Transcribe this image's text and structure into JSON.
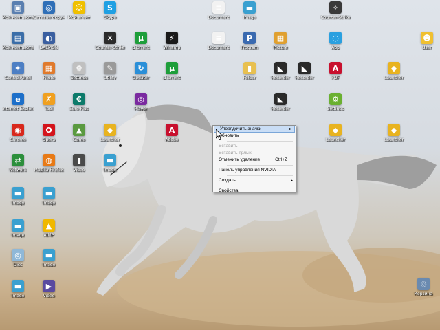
{
  "desktop": {
    "icons": [
      {
        "id": "mycomp1",
        "label": "Мой компьютер",
        "color": "#5a7fb0",
        "glyph": "▣",
        "l": 3,
        "t": 0
      },
      {
        "id": "net",
        "label": "Сетевое окружение",
        "color": "#2f6fb7",
        "glyph": "◎",
        "l": 48,
        "t": 0
      },
      {
        "id": "msg",
        "label": "Мой агент",
        "color": "#f0c000",
        "glyph": "☺",
        "l": 92,
        "t": 0
      },
      {
        "id": "skype",
        "label": "Skype",
        "color": "#1fa0e3",
        "glyph": "S",
        "l": 137,
        "t": 0
      },
      {
        "id": "mycomp2",
        "label": "Мой компьютер",
        "color": "#3b6ea8",
        "glyph": "▤",
        "l": 3,
        "t": 44
      },
      {
        "id": "daemon",
        "label": "DAEMON",
        "color": "#3a5fa0",
        "glyph": "◐",
        "l": 48,
        "t": 44
      },
      {
        "id": "counter",
        "label": "Counter-Strike",
        "color": "#2c2c2c",
        "glyph": "✕",
        "l": 137,
        "t": 44
      },
      {
        "id": "utorrent1",
        "label": "µTorrent",
        "color": "#1d9e3a",
        "glyph": "µ",
        "l": 182,
        "t": 44
      },
      {
        "id": "winamp",
        "label": "Winamp",
        "color": "#1a1a1a",
        "glyph": "⚡",
        "l": 227,
        "t": 44
      },
      {
        "id": "gear",
        "label": "ControlPanel",
        "color": "#4d7fc4",
        "glyph": "✦",
        "l": 3,
        "t": 88
      },
      {
        "id": "photo",
        "label": "Photo",
        "color": "#e07a2c",
        "glyph": "▦",
        "l": 48,
        "t": 88
      },
      {
        "id": "settings",
        "label": "Settings",
        "color": "#c0c0c0",
        "glyph": "⚙",
        "l": 92,
        "t": 88
      },
      {
        "id": "iron",
        "label": "Utility",
        "color": "#9a9a9a",
        "glyph": "✎",
        "l": 137,
        "t": 88
      },
      {
        "id": "updater",
        "label": "Updater",
        "color": "#2a8fd8",
        "glyph": "↻",
        "l": 182,
        "t": 88
      },
      {
        "id": "utorrent2",
        "label": "µTorrent",
        "color": "#1d9e3a",
        "glyph": "µ",
        "l": 227,
        "t": 88
      },
      {
        "id": "ie",
        "label": "Internet Explorer",
        "color": "#1d6fc9",
        "glyph": "e",
        "l": 3,
        "t": 133
      },
      {
        "id": "tool",
        "label": "Tool",
        "color": "#f0a020",
        "glyph": "✗",
        "l": 48,
        "t": 133
      },
      {
        "id": "euro",
        "label": "Euro Plus",
        "color": "#0c7a6a",
        "glyph": "€",
        "l": 92,
        "t": 133
      },
      {
        "id": "chrome",
        "label": "Chrome",
        "color": "#d8281c",
        "glyph": "◉",
        "l": 3,
        "t": 178
      },
      {
        "id": "opera",
        "label": "Opera",
        "color": "#d4141c",
        "glyph": "O",
        "l": 48,
        "t": 178
      },
      {
        "id": "game1",
        "label": "Game",
        "color": "#5a9a40",
        "glyph": "▲",
        "l": 92,
        "t": 178
      },
      {
        "id": "cube1",
        "label": "Launcher",
        "color": "#e8b320",
        "glyph": "◆",
        "l": 137,
        "t": 178
      },
      {
        "id": "adobe",
        "label": "Adobe",
        "color": "#c8102e",
        "glyph": "A",
        "l": 227,
        "t": 178
      },
      {
        "id": "net2",
        "label": "Network",
        "color": "#2c8f3c",
        "glyph": "⇄",
        "l": 3,
        "t": 222
      },
      {
        "id": "firefox",
        "label": "Mozilla Firefox",
        "color": "#e87a16",
        "glyph": "◍",
        "l": 48,
        "t": 222
      },
      {
        "id": "film",
        "label": "Video",
        "color": "#4a4a4a",
        "glyph": "▮",
        "l": 92,
        "t": 222
      },
      {
        "id": "img1",
        "label": "Image",
        "color": "#3aa0d0",
        "glyph": "▬",
        "l": 137,
        "t": 222
      },
      {
        "id": "img2",
        "label": "Image",
        "color": "#3aa0d0",
        "glyph": "▬",
        "l": 3,
        "t": 270
      },
      {
        "id": "img3",
        "label": "Image",
        "color": "#3aa0d0",
        "glyph": "▬",
        "l": 48,
        "t": 270
      },
      {
        "id": "img4",
        "label": "Image",
        "color": "#3aa0d0",
        "glyph": "▬",
        "l": 3,
        "t": 317
      },
      {
        "id": "aimp",
        "label": "AIMP",
        "color": "#f0b800",
        "glyph": "▲",
        "l": 48,
        "t": 317
      },
      {
        "id": "cd",
        "label": "Disc",
        "color": "#8fb8d8",
        "glyph": "◎",
        "l": 3,
        "t": 360
      },
      {
        "id": "img5",
        "label": "Image",
        "color": "#3aa0d0",
        "glyph": "▬",
        "l": 48,
        "t": 360
      },
      {
        "id": "img6",
        "label": "Image",
        "color": "#3aa0d0",
        "glyph": "▬",
        "l": 3,
        "t": 405
      },
      {
        "id": "film2",
        "label": "Video",
        "color": "#5a4aa0",
        "glyph": "▶",
        "l": 48,
        "t": 405
      },
      {
        "id": "word1",
        "label": "Document",
        "color": "#f2f2f2",
        "glyph": "≡",
        "l": 295,
        "t": 0
      },
      {
        "id": "img7",
        "label": "Image",
        "color": "#3aa0d0",
        "glyph": "▬",
        "l": 340,
        "t": 0
      },
      {
        "id": "cs2",
        "label": "Counter-Strike",
        "color": "#3a3a3a",
        "glyph": "✧",
        "l": 465,
        "t": 0
      },
      {
        "id": "doc2",
        "label": "Document",
        "color": "#f2f2f2",
        "glyph": "≡",
        "l": 295,
        "t": 44
      },
      {
        "id": "pp",
        "label": "Program",
        "color": "#3a6ab0",
        "glyph": "P",
        "l": 340,
        "t": 44
      },
      {
        "id": "pic",
        "label": "Picture",
        "color": "#e0a030",
        "glyph": "▦",
        "l": 385,
        "t": 44
      },
      {
        "id": "app",
        "label": "App",
        "color": "#2aa0e0",
        "glyph": "◌",
        "l": 465,
        "t": 44
      },
      {
        "id": "user",
        "label": "User",
        "color": "#f0c030",
        "glyph": "☻",
        "l": 598,
        "t": 44
      },
      {
        "id": "folder",
        "label": "Folder",
        "color": "#e8c050",
        "glyph": "▮",
        "l": 340,
        "t": 88
      },
      {
        "id": "rec1",
        "label": "Recorder",
        "color": "#2a2a2a",
        "glyph": "◣",
        "l": 385,
        "t": 88
      },
      {
        "id": "rec2",
        "label": "Recorder",
        "color": "#2a2a2a",
        "glyph": "◣",
        "l": 420,
        "t": 88
      },
      {
        "id": "pdf",
        "label": "PDF",
        "color": "#c8102e",
        "glyph": "A",
        "l": 465,
        "t": 88
      },
      {
        "id": "cube2",
        "label": "Launcher",
        "color": "#e8b320",
        "glyph": "◆",
        "l": 550,
        "t": 88
      },
      {
        "id": "rec3",
        "label": "Recorder",
        "color": "#2a2a2a",
        "glyph": "◣",
        "l": 385,
        "t": 133
      },
      {
        "id": "gear2",
        "label": "Settings",
        "color": "#6ab030",
        "glyph": "⚙",
        "l": 465,
        "t": 133
      },
      {
        "id": "cube3",
        "label": "Launcher",
        "color": "#e8b320",
        "glyph": "◆",
        "l": 465,
        "t": 178
      },
      {
        "id": "cube4",
        "label": "Launcher",
        "color": "#e8b320",
        "glyph": "◆",
        "l": 550,
        "t": 178
      },
      {
        "id": "purple",
        "label": "Player",
        "color": "#7a2aa0",
        "glyph": "◎",
        "l": 182,
        "t": 133
      },
      {
        "id": "recycle",
        "label": "Корзина",
        "color": "#6a8ab0",
        "glyph": "♲",
        "l": 593,
        "t": 402
      }
    ]
  },
  "context_menu": {
    "items": [
      {
        "type": "item",
        "label": "Упорядочить значки",
        "arrow": "▸",
        "highlight": true
      },
      {
        "type": "item",
        "label": "Обновить"
      },
      {
        "type": "sep"
      },
      {
        "type": "item",
        "label": "Вставить",
        "disabled": true
      },
      {
        "type": "item",
        "label": "Вставить ярлык",
        "disabled": true
      },
      {
        "type": "item",
        "label": "Отменить удаление",
        "shortcut": "Ctrl+Z"
      },
      {
        "type": "sep"
      },
      {
        "type": "item",
        "label": "Панель управления NVIDIA"
      },
      {
        "type": "sep"
      },
      {
        "type": "item",
        "label": "Создать",
        "arrow": "▸"
      },
      {
        "type": "sep"
      },
      {
        "type": "item",
        "label": "Свойства"
      }
    ]
  }
}
